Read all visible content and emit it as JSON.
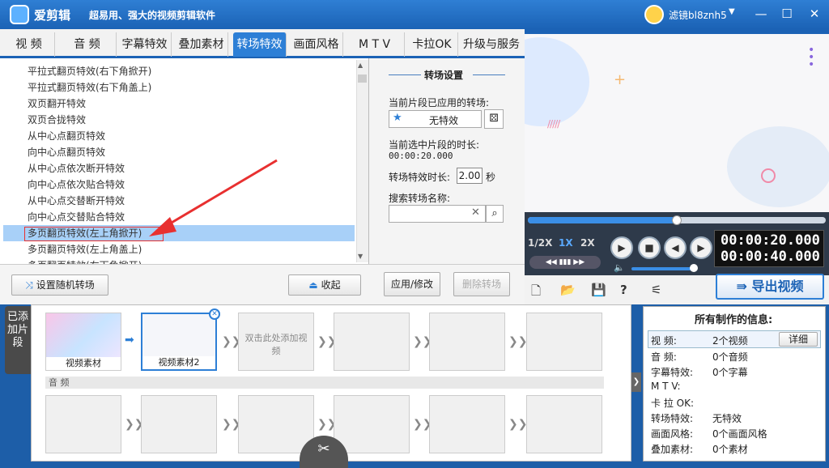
{
  "titlebar": {
    "app_name": "爱剪辑",
    "slogan": "超易用、强大的视频剪辑软件",
    "username": "滤镜bl8znh5"
  },
  "tabs": [
    "视 频",
    "音 频",
    "字幕特效",
    "叠加素材",
    "转场特效",
    "画面风格",
    "M T V",
    "卡拉OK",
    "升级与服务"
  ],
  "transitions": [
    "平拉式翻页特效(右下角掀开)",
    "平拉式翻页特效(右下角盖上)",
    "双页翻开特效",
    "双页合拢特效",
    "从中心点翻页特效",
    "向中心点翻页特效",
    "从中心点依次断开特效",
    "向中心点依次贴合特效",
    "从中心点交替断开特效",
    "向中心点交替贴合特效",
    "多页翻页特效(左上角掀开)",
    "多页翻页特效(左上角盖上)",
    "多页翻页特效(右下角掀开)"
  ],
  "settings": {
    "title": "转场设置",
    "applied_label": "当前片段已应用的转场:",
    "applied_value": "无特效",
    "duration_label": "当前选中片段的时长:",
    "duration_value": "00:00:20.000",
    "effect_duration_label": "转场特效时长:",
    "effect_duration_value": "2.00",
    "unit": "秒",
    "search_label": "搜索转场名称:"
  },
  "buttons": {
    "random": "设置随机转场",
    "collapse": "收起",
    "apply": "应用/修改",
    "delete": "删除转场"
  },
  "player": {
    "speeds": [
      "1/2X",
      "1X",
      "2X"
    ],
    "time_current": "00:00:20.000",
    "time_total": "00:00:40.000",
    "progress": 0.5
  },
  "export_label": "导出视频",
  "timeline": {
    "side_label": "已添加片段",
    "clips": [
      "视频素材",
      "视频素材2"
    ],
    "add_hint": "双击此处添加视频",
    "audio_label": "音 频"
  },
  "info": {
    "title": "所有制作的信息:",
    "detail_btn": "详细",
    "rows": [
      {
        "k": "视    频:",
        "v": "2个视频"
      },
      {
        "k": "音    频:",
        "v": "0个音频"
      },
      {
        "k": "字幕特效:",
        "v": "0个字幕"
      },
      {
        "k": "M  T  V:",
        "v": ""
      },
      {
        "k": "卡 拉 OK:",
        "v": ""
      },
      {
        "k": "转场特效:",
        "v": "无特效"
      },
      {
        "k": "画面风格:",
        "v": "0个画面风格"
      },
      {
        "k": "叠加素材:",
        "v": "0个素材"
      }
    ]
  }
}
